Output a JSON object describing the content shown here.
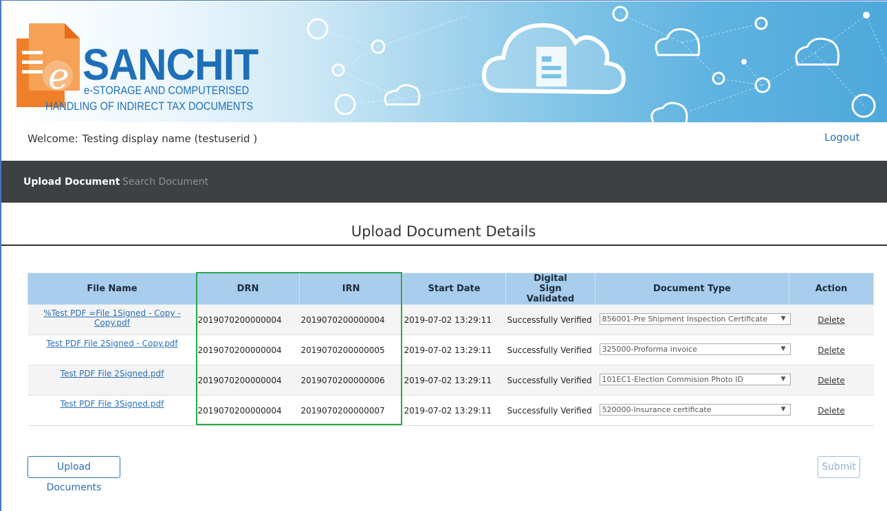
{
  "banner": {
    "logo_word": "SANCHIT",
    "logo_line1": "e-STORAGE AND COMPUTERISED",
    "logo_line2": "HANDLING OF INDIRECT TAX DOCUMENTS",
    "logo_letter": "e"
  },
  "header": {
    "welcome_prefix": "Welcome:",
    "user_display": "Testing display name (testuserid )",
    "logout_label": "Logout"
  },
  "nav": {
    "items": [
      {
        "label": "Upload Document",
        "active": true
      },
      {
        "label": "Search Document",
        "active": false
      }
    ]
  },
  "main": {
    "title": "Upload Document Details",
    "table": {
      "columns": [
        "File Name",
        "DRN",
        "IRN",
        "Start Date",
        "Digital Sign Validated",
        "Document Type",
        "Action"
      ],
      "rows": [
        {
          "file": "%Test PDF =File 1Signed - Copy - Copy.pdf",
          "drn": "2019070200000004",
          "irn": "2019070200000004",
          "start_date": "2019-07-02 13:29:11",
          "sign": "Successfully Verified",
          "doc_type": "856001-Pre Shipment Inspection Certificate",
          "action": "Delete"
        },
        {
          "file": "Test PDF File 2Signed - Copy.pdf",
          "drn": "2019070200000004",
          "irn": "2019070200000005",
          "start_date": "2019-07-02 13:29:11",
          "sign": "Successfully Verified",
          "doc_type": "325000-Proforma invoice",
          "action": "Delete"
        },
        {
          "file": "Test PDF File 2Signed.pdf",
          "drn": "2019070200000004",
          "irn": "2019070200000006",
          "start_date": "2019-07-02 13:29:11",
          "sign": "Successfully Verified",
          "doc_type": "101EC1-Election Commision Photo ID",
          "action": "Delete"
        },
        {
          "file": "Test PDF File 3Signed.pdf",
          "drn": "2019070200000004",
          "irn": "2019070200000007",
          "start_date": "2019-07-02 13:29:11",
          "sign": "Successfully Verified",
          "doc_type": "520000-Insurance certificate",
          "action": "Delete"
        }
      ]
    },
    "upload_button": "Upload Documents",
    "submit_button": "Submit"
  },
  "colors": {
    "accent": "#2a6fb5",
    "navbar": "#3d4143",
    "table_header": "#a9cdec",
    "highlight_box": "#2aa84a",
    "logo_orange": "#f07f2a"
  },
  "icons": [
    "document-logo-icon",
    "location-pin-icon",
    "lock-icon",
    "dollar-icon",
    "camera-icon",
    "wifi-icon",
    "cloud-document-icon",
    "monitor-icon",
    "mail-icon",
    "search-icon",
    "mobile-icon",
    "globe-icon",
    "dropdown-caret-icon"
  ]
}
